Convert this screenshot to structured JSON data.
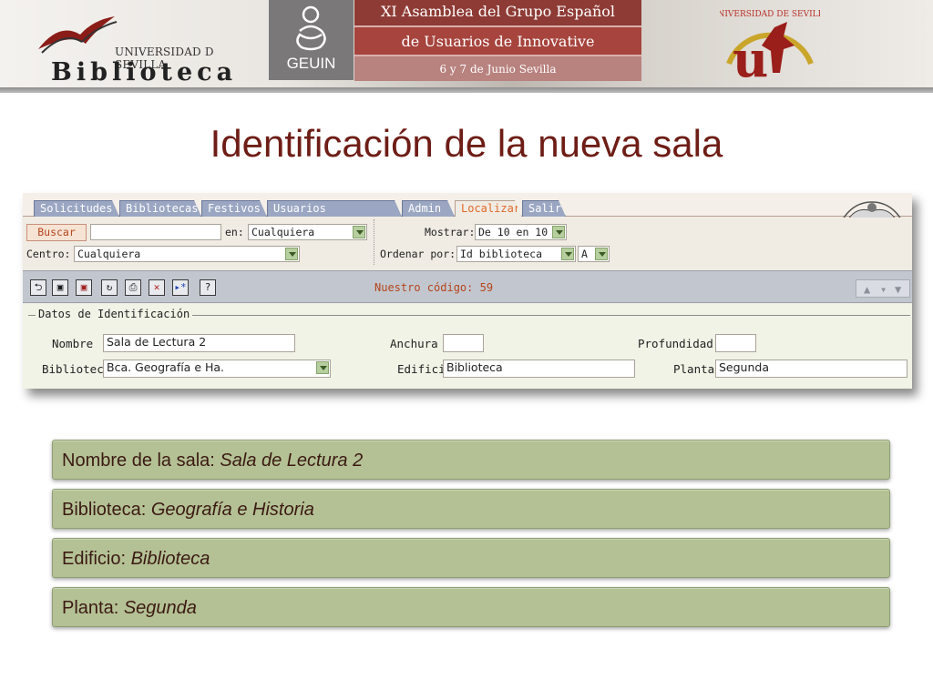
{
  "banner": {
    "library_university": "UNIVERSIDAD D SEVILLA",
    "library_name": "Biblioteca",
    "geuin_label": "GEUIN",
    "asamblea_line1": "XI Asamblea del Grupo Español",
    "asamblea_line2": "de Usuarios de Innovative",
    "asamblea_line3": "6 y 7 de Junio Sevilla",
    "seal_text": "UNIVERSIDAD DE SEVILLA"
  },
  "slide_title": "Identificación de la nueva sala",
  "app": {
    "tabs": [
      {
        "label": "Solicitudes",
        "active": false
      },
      {
        "label": "Bibliotecas",
        "active": false
      },
      {
        "label": "Festivos",
        "active": false
      },
      {
        "label": "Usuarios Millennium",
        "active": false
      },
      {
        "label": "Admin",
        "active": false
      },
      {
        "label": "Localizar",
        "active": true
      },
      {
        "label": "Salir",
        "active": false
      }
    ],
    "search": {
      "button_label": "Buscar",
      "query_value": "",
      "en_label": "en:",
      "en_value": "Cualquiera",
      "centro_label": "Centro:",
      "centro_value": "Cualquiera",
      "mostrar_label": "Mostrar:",
      "mostrar_value": "De 10 en 10",
      "ordenar_label": "Ordenar por:",
      "ordenar_value": "Id biblioteca",
      "orden_dir_value": "A"
    },
    "toolbar": {
      "codigo_text": "Nuestro código: 59",
      "icons": [
        "back-icon",
        "save-icon",
        "save-as-icon",
        "refresh-icon",
        "print-icon",
        "delete-icon",
        "new-record-icon",
        "help-icon"
      ]
    },
    "form": {
      "legend": "Datos de Identificación",
      "nombre_label": "Nombre",
      "nombre_value": "Sala de Lectura 2",
      "biblioteca_label": "Biblioteca",
      "biblioteca_value": "Bca. Geografía e Ha.",
      "anchura_label": "Anchura",
      "anchura_value": "",
      "edificio_label": "Edificio",
      "edificio_value": "Biblioteca",
      "profundidad_label": "Profundidad",
      "profundidad_value": "",
      "planta_label": "Planta",
      "planta_value": "Segunda"
    }
  },
  "info": [
    {
      "label": "Nombre de la sala:",
      "value": "Sala de Lectura 2"
    },
    {
      "label": "Biblioteca:",
      "value": "Geografía e Historia"
    },
    {
      "label": "Edificio:",
      "value": "Biblioteca"
    },
    {
      "label": "Planta:",
      "value": "Segunda"
    }
  ],
  "colors": {
    "title": "#6e1d16",
    "accent_orange": "#e06a2a",
    "bar_green": "#b4c195"
  }
}
